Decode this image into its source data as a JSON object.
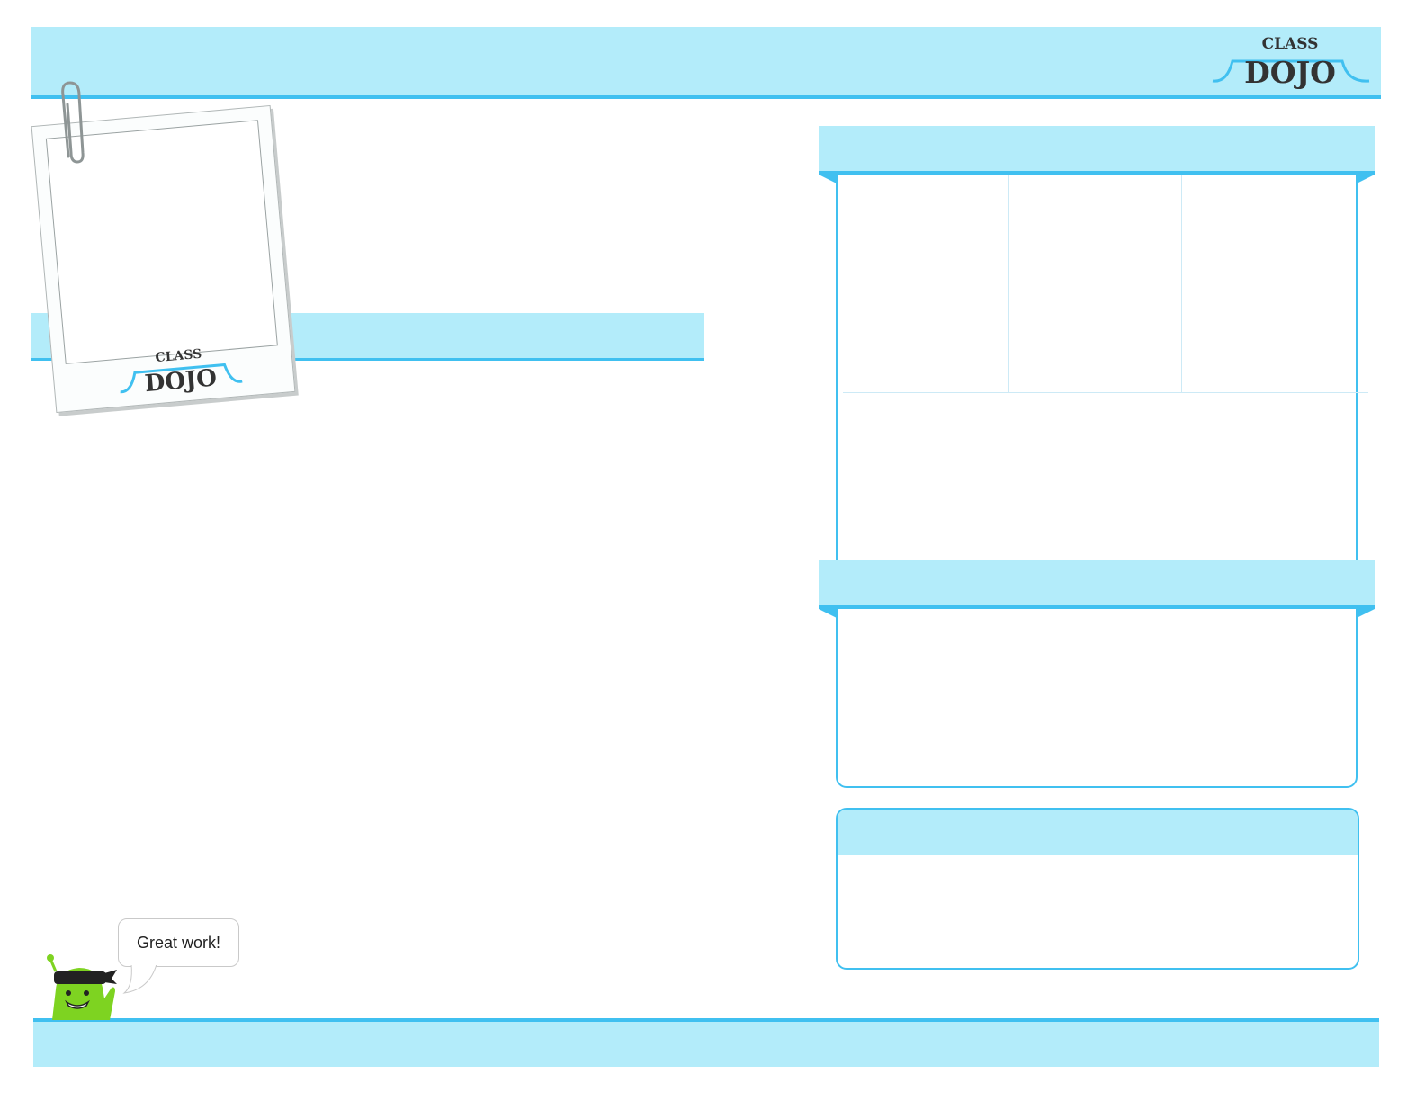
{
  "header": {
    "logo_text_top": "CLASS",
    "logo_text_main": "DOJO"
  },
  "polaroid": {
    "logo_text_top": "CLASS",
    "logo_text_main": "DOJO"
  },
  "mascot": {
    "speech": "Great work!"
  },
  "colors": {
    "band": "#b3ecfa",
    "accent": "#40c0f0",
    "mascot": "#7ed321"
  },
  "icons": [
    "paperclip-icon",
    "mascot-icon"
  ]
}
